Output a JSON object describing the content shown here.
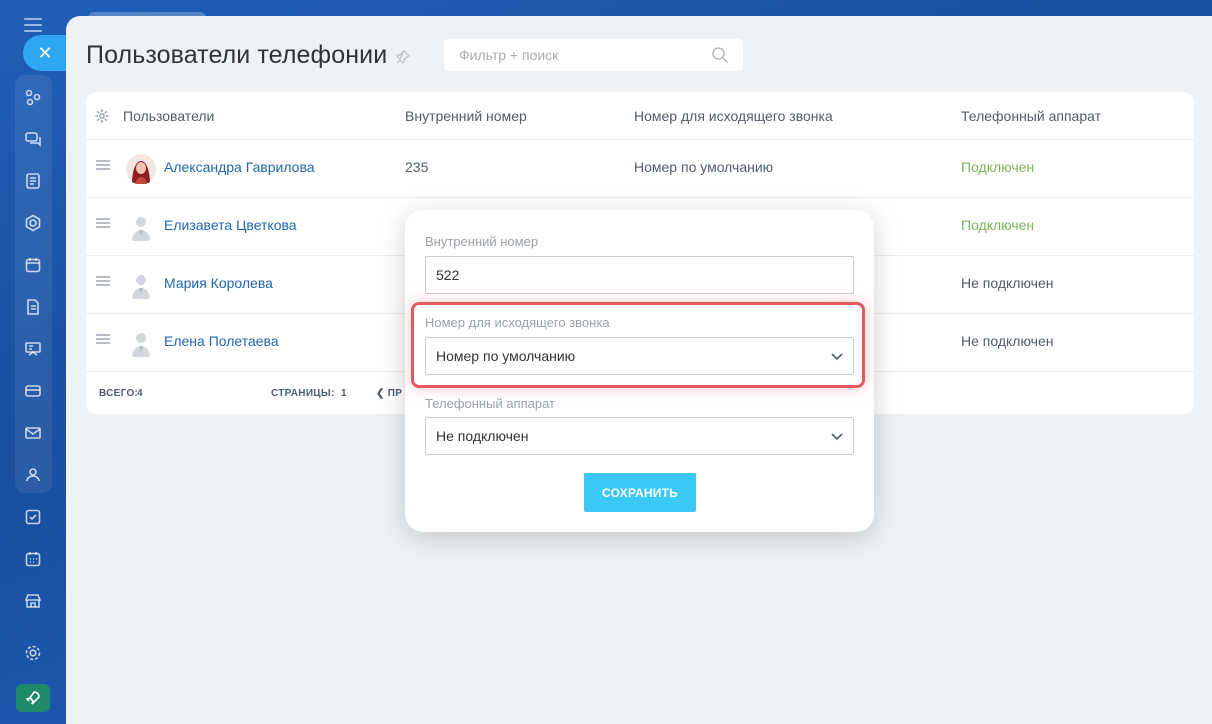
{
  "page": {
    "title": "Пользователи телефонии",
    "search_placeholder": "Фильтр + поиск"
  },
  "table": {
    "headers": [
      "Пользователи",
      "Внутренний номер",
      "Номер для исходящего звонка",
      "Телефонный аппарат"
    ],
    "rows": [
      {
        "name": "Александра Гаврилова",
        "ext": "235",
        "outgoing": "Номер по умолчанию",
        "phone": "Подключен",
        "connected": true
      },
      {
        "name": "Елизавета Цветкова",
        "ext": "",
        "outgoing": "",
        "phone": "Подключен",
        "connected": true
      },
      {
        "name": "Мария Королева",
        "ext": "",
        "outgoing": "",
        "phone": "Не подключен",
        "connected": false
      },
      {
        "name": "Елена Полетаева",
        "ext": "",
        "outgoing": "",
        "phone": "Не подключен",
        "connected": false
      }
    ],
    "footer": {
      "total_label": "ВСЕГО:",
      "total_value": "4",
      "pages_label": "СТРАНИЦЫ:",
      "pages_value": "1",
      "prev_label": "ПР"
    }
  },
  "modal": {
    "ext_label": "Внутренний номер",
    "ext_value": "522",
    "outgoing_label": "Номер для исходящего звонка",
    "outgoing_value": "Номер по умолчанию",
    "phone_label": "Телефонный аппарат",
    "phone_value": "Не подключен",
    "save_label": "СОХРАНИТЬ"
  },
  "colors": {
    "accent": "#3bc8f5",
    "link": "#2067b0",
    "connected": "#7bb35a",
    "highlight": "#e05a5f"
  },
  "icons": [
    "menu-icon",
    "close-icon",
    "pin-icon",
    "search-icon",
    "settings-icon",
    "drag-handle-icon",
    "chevron-down-icon",
    "rocket-icon"
  ]
}
